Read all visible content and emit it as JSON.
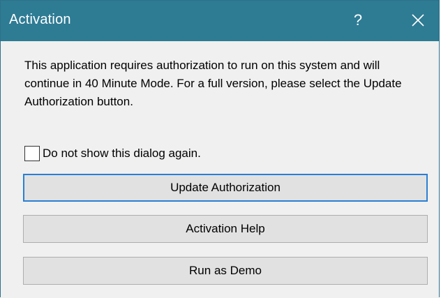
{
  "window": {
    "title": "Activation",
    "help_glyph": "?",
    "close_icon": "close-icon"
  },
  "dialog": {
    "message": "This application requires authorization to run on this system and will continue in 40 Minute Mode. For a full version, please select the Update Authorization button.",
    "checkbox": {
      "label": "Do not show this dialog again.",
      "checked": false
    },
    "buttons": {
      "update_authorization": "Update Authorization",
      "activation_help": "Activation Help",
      "run_as_demo": "Run as Demo"
    }
  },
  "colors": {
    "titlebar": "#2e7b94",
    "default_button_border": "#2a7fd4",
    "button_face": "#e1e1e1"
  }
}
